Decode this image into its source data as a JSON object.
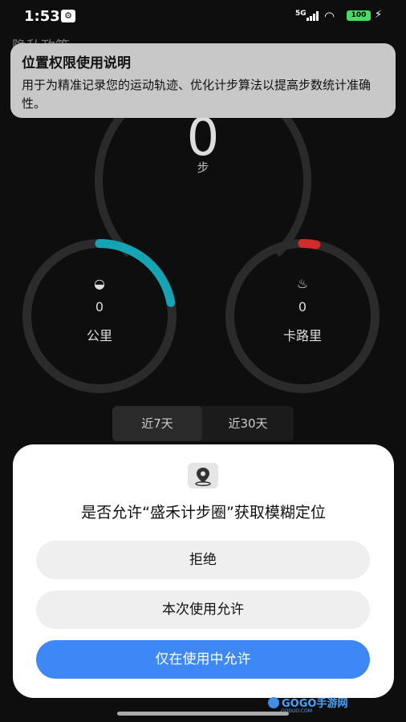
{
  "status_bar": {
    "time": "1:53",
    "network": "5G",
    "battery": "100"
  },
  "background": {
    "page_title": "隐私政策",
    "steps_value": "0",
    "steps_unit": "步",
    "distance_value": "0",
    "distance_unit": "公里",
    "calories_value": "0",
    "calories_unit": "卡路里",
    "distance_progress": 0.22,
    "calories_progress": 0.03,
    "colors": {
      "distance": "#16a3b3",
      "calories": "#d12b2b"
    },
    "tabs": [
      "近7天",
      "近30天"
    ],
    "selected_tab": 0
  },
  "toast": {
    "title": "位置权限使用说明",
    "body": "用于为精准记录您的运动轨迹、优化计步算法以提高步数统计准确性。"
  },
  "dialog": {
    "icon": "location-pin-icon",
    "question": "是否允许“盛禾计步圈”获取模糊定位",
    "buttons": {
      "deny": "拒绝",
      "allow_once": "本次使用允许",
      "allow_while_using": "仅在使用中允许"
    },
    "primary_color": "#3d88f5"
  },
  "watermark": {
    "text": "GOGO手游网",
    "sub": "GOGUO.COM"
  }
}
